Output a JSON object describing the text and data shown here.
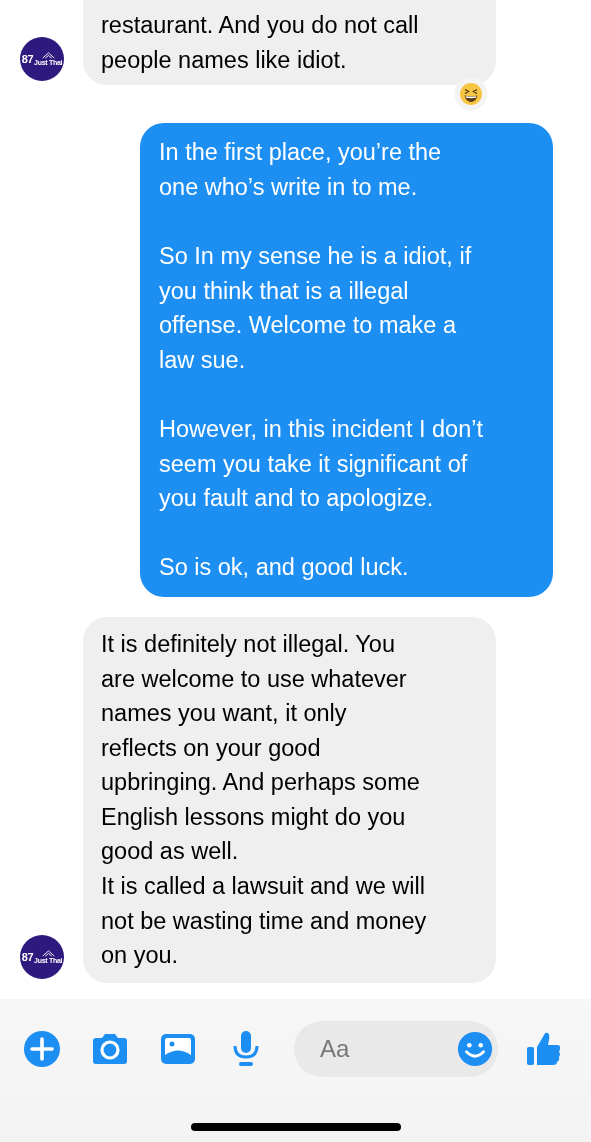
{
  "messages": [
    {
      "kind": "incoming",
      "avatar": {
        "number": "87",
        "brand": "Just Thai"
      },
      "reaction": true,
      "paragraphs": [
        [
          "restaurant. And you do not call",
          "people names like idiot."
        ]
      ]
    },
    {
      "kind": "outgoing",
      "reaction": false,
      "paragraphs": [
        [
          "In the first place, you’re the",
          "one who’s write in to me."
        ],
        [
          "So In my sense he is a idiot, if",
          "you think that is a illegal",
          "offense. Welcome to make a",
          "law sue."
        ],
        [
          "However, in this incident I don’t",
          "seem you take it significant of",
          "you fault and to apologize."
        ],
        [
          "So is ok, and good luck."
        ]
      ]
    },
    {
      "kind": "incoming",
      "avatar": {
        "number": "87",
        "brand": "Just Thai"
      },
      "reaction": false,
      "paragraphs": [
        [
          "It is definitely not illegal. You",
          "are welcome to use whatever",
          "names you want, it only",
          "reflects on your good",
          "upbringing. And perhaps some",
          "English lessons might do you",
          "good as well.",
          "It is called a lawsuit and we will",
          "not be wasting time and money",
          "on you."
        ]
      ]
    }
  ],
  "composer": {
    "placeholder": "Aa"
  }
}
